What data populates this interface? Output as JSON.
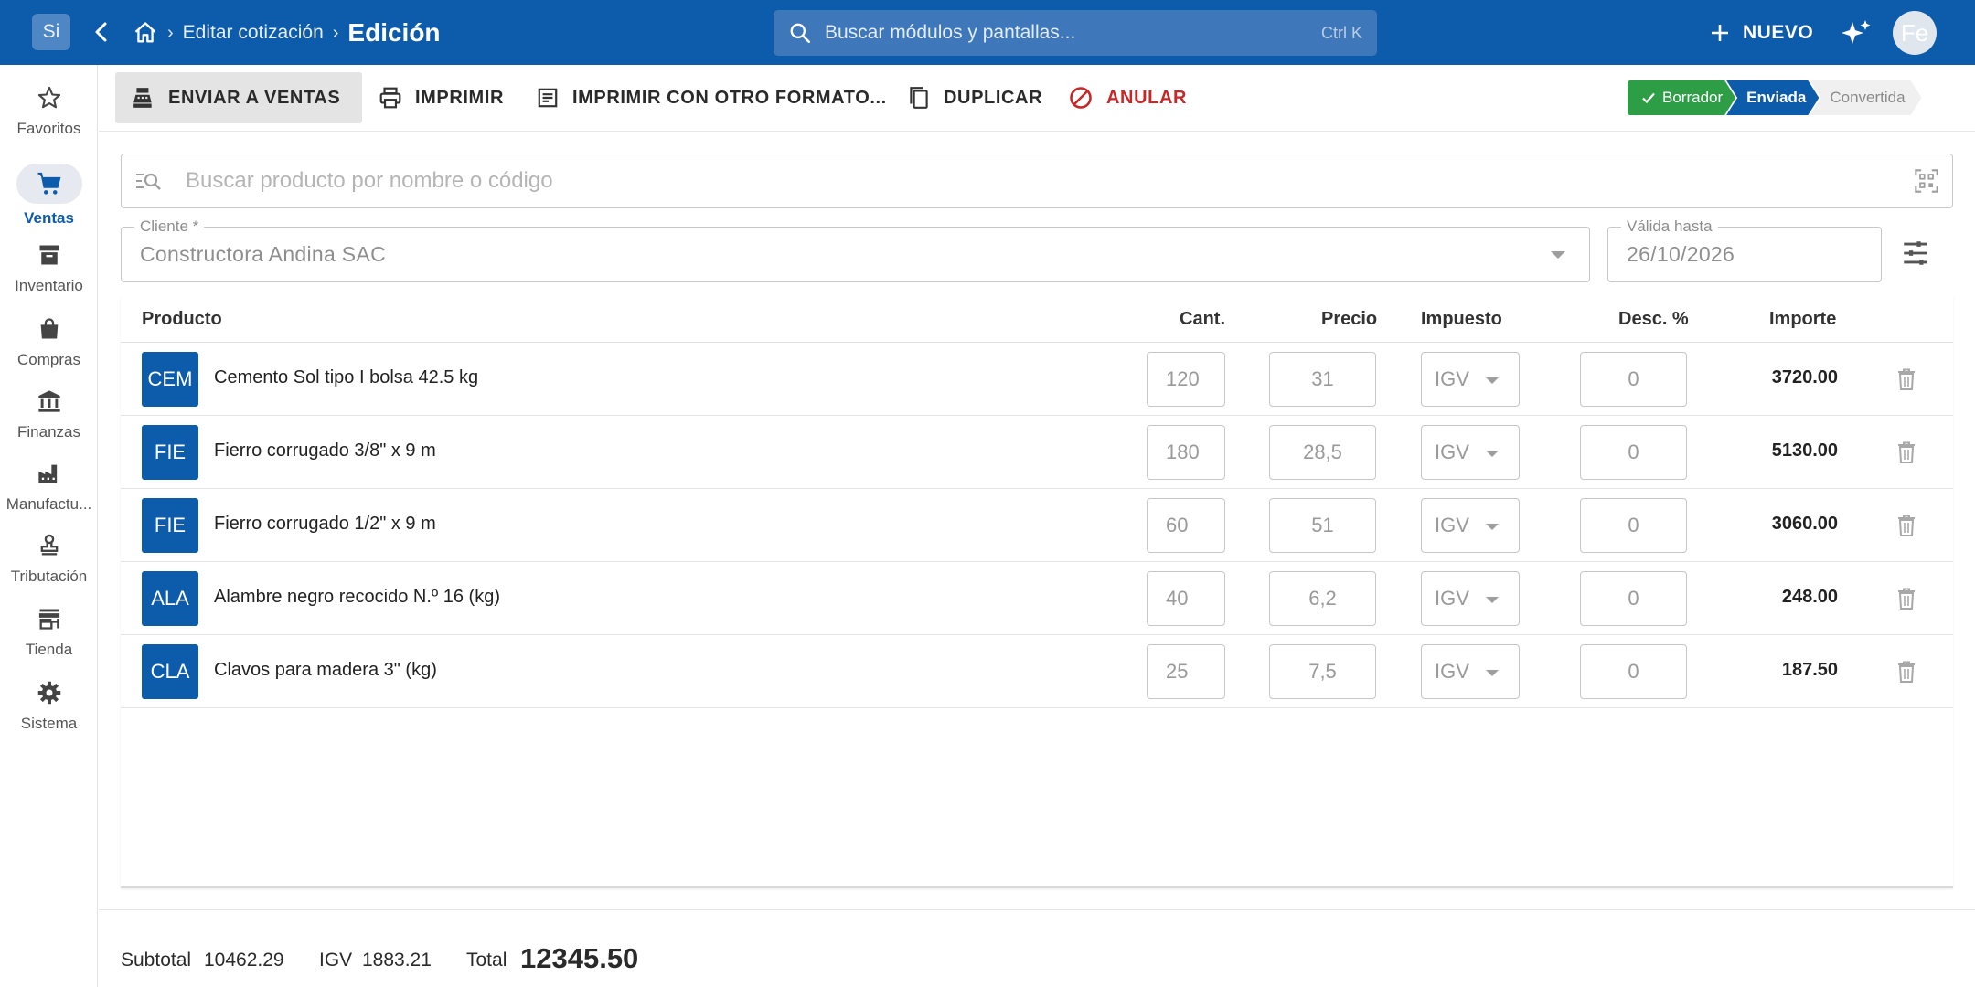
{
  "topbar": {
    "logo_initials": "Si",
    "breadcrumb_parent": "Editar cotización",
    "breadcrumb_current": "Edición",
    "search_placeholder": "Buscar módulos y pantallas...",
    "search_shortcut": "Ctrl K",
    "new_label": "NUEVO",
    "avatar_initials": "Fe"
  },
  "sidebar": {
    "items": [
      {
        "label": "Favoritos",
        "icon": "star-icon"
      },
      {
        "label": "Ventas",
        "icon": "cart-icon",
        "active": true
      },
      {
        "label": "Inventario",
        "icon": "archive-icon"
      },
      {
        "label": "Compras",
        "icon": "bag-icon"
      },
      {
        "label": "Finanzas",
        "icon": "bank-icon"
      },
      {
        "label": "Manufactu...",
        "icon": "factory-icon"
      },
      {
        "label": "Tributación",
        "icon": "stamp-icon"
      },
      {
        "label": "Tienda",
        "icon": "store-icon"
      },
      {
        "label": "Sistema",
        "icon": "gear-icon"
      }
    ]
  },
  "toolbar": {
    "send_label": "ENVIAR A VENTAS",
    "print_label": "IMPRIMIR",
    "print_other_label": "IMPRIMIR CON OTRO FORMATO...",
    "duplicate_label": "DUPLICAR",
    "void_label": "ANULAR"
  },
  "status_steps": [
    "Borrador",
    "Enviada",
    "Convertida"
  ],
  "product_search": {
    "placeholder": "Buscar producto por nombre o código"
  },
  "client": {
    "label": "Cliente *",
    "value": "Constructora Andina SAC"
  },
  "valid_until": {
    "label": "Válida hasta",
    "value": "26/10/2026"
  },
  "table": {
    "headers": {
      "product": "Producto",
      "qty": "Cant.",
      "price": "Precio",
      "tax": "Impuesto",
      "discount": "Desc. %",
      "amount": "Importe"
    },
    "rows": [
      {
        "code": "CEM",
        "name": "Cemento Sol tipo I bolsa 42.5 kg",
        "qty": "120",
        "price": "31",
        "tax": "IGV",
        "discount": "0",
        "amount": "3720.00"
      },
      {
        "code": "FIE",
        "name": "Fierro corrugado 3/8\" x 9 m",
        "qty": "180",
        "price": "28,5",
        "tax": "IGV",
        "discount": "0",
        "amount": "5130.00"
      },
      {
        "code": "FIE",
        "name": "Fierro corrugado 1/2\" x 9 m",
        "qty": "60",
        "price": "51",
        "tax": "IGV",
        "discount": "0",
        "amount": "3060.00"
      },
      {
        "code": "ALA",
        "name": "Alambre negro recocido N.º 16 (kg)",
        "qty": "40",
        "price": "6,2",
        "tax": "IGV",
        "discount": "0",
        "amount": "248.00"
      },
      {
        "code": "CLA",
        "name": "Clavos para madera 3\" (kg)",
        "qty": "25",
        "price": "7,5",
        "tax": "IGV",
        "discount": "0",
        "amount": "187.50"
      }
    ]
  },
  "totals": {
    "subtotal_label": "Subtotal",
    "subtotal": "10462.29",
    "igv_label": "IGV",
    "igv": "1883.21",
    "total_label": "Total",
    "total": "12345.50"
  },
  "colors": {
    "primary": "#0d5bab",
    "success": "#2e9e46",
    "danger": "#c62828"
  }
}
